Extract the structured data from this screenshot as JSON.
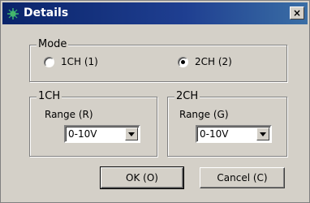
{
  "window": {
    "title": "Details",
    "close_label": "×"
  },
  "mode": {
    "label": "Mode",
    "options": [
      {
        "label": "1CH (1)",
        "checked": false
      },
      {
        "label": "2CH (2)",
        "checked": true
      }
    ]
  },
  "ch1": {
    "label": "1CH",
    "range_label": "Range (R)",
    "value": "0-10V"
  },
  "ch2": {
    "label": "2CH",
    "range_label": "Range (G)",
    "value": "0-10V"
  },
  "buttons": {
    "ok": "OK (O)",
    "cancel": "Cancel (C)"
  }
}
